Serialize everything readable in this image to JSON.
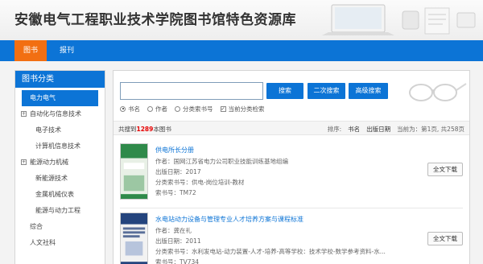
{
  "header": {
    "title": "安徽电气工程职业技术学院图书馆特色资源库"
  },
  "nav": {
    "items": [
      {
        "label": "图书"
      },
      {
        "label": "报刊"
      }
    ]
  },
  "sidebar": {
    "title": "图书分类",
    "items": [
      {
        "label": "电力电气",
        "level": "active"
      },
      {
        "label": "自动化与信息技术",
        "toggle": "+"
      },
      {
        "label": "电子技术"
      },
      {
        "label": "计算机信息技术"
      },
      {
        "label": "能源动力机械",
        "toggle": "+"
      },
      {
        "label": "新能源技术"
      },
      {
        "label": "金属机械仪表"
      },
      {
        "label": "能源与动力工程"
      },
      {
        "label": "综合"
      },
      {
        "label": "人文社科"
      }
    ]
  },
  "search": {
    "input_value": "",
    "buttons": {
      "search": "搜索",
      "second": "二次搜索",
      "advanced": "高级搜索"
    },
    "filters": {
      "title": "书名",
      "author": "作者",
      "class_no": "分类索书号",
      "current_class": "当前分类检索"
    }
  },
  "results": {
    "count_prefix": "共搜到",
    "count": "1289",
    "count_suffix": "本图书",
    "sort_label": "排序:",
    "sort_options": [
      "书名",
      "出版日期"
    ],
    "pager": "当前为：第1页, 共258页"
  },
  "books": [
    {
      "title": "供电所长分册",
      "author": "作者：国网江苏省电力公司职业技能训练基地组编",
      "date": "出版日期：2017",
      "class": "分类索书号：供电-岗位培训-教材",
      "call_no": "索书号：TM72",
      "download": "全文下载",
      "cover_text": "供电所长分册"
    },
    {
      "title": "水电站动力设备与管理专业人才培养方案与课程标准",
      "author": "作者：龚在礼",
      "date": "出版日期：2011",
      "class": "分类索书号：水利发电站-动力装置-人才-培养-高等学校：技术学校-数学参考资料-水...",
      "call_no": "索书号：TV734",
      "download": "全文下载",
      "cover_text": "水电站动力设备与管理"
    }
  ],
  "colors": {
    "primary": "#0c74d6",
    "accent": "#f26f12",
    "count": "#e60000"
  }
}
